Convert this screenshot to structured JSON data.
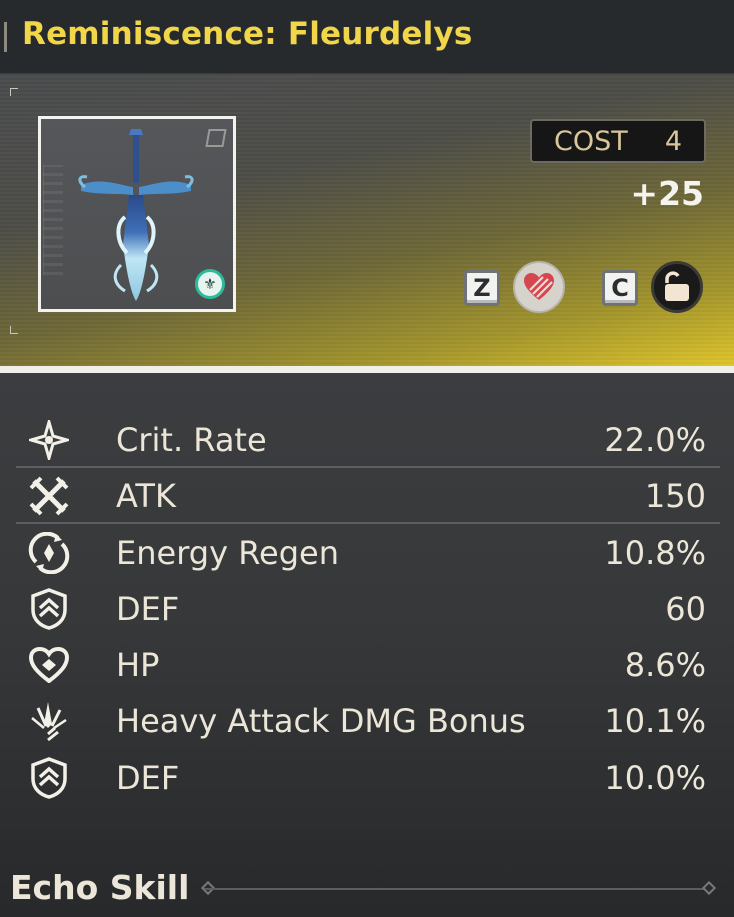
{
  "header": {
    "title": "Reminiscence: Fleurdelys"
  },
  "echo": {
    "cost_label": "COST",
    "cost_value": "4",
    "level": "+25",
    "keys": {
      "favorite_key": "Z",
      "lock_key": "C"
    },
    "sonata_icon": "fleur-sonata-icon",
    "accent_color": "#f2d64a"
  },
  "stats": [
    {
      "icon": "crit-rate-icon",
      "name": "Crit. Rate",
      "value": "22.0%"
    },
    {
      "icon": "atk-icon",
      "name": "ATK",
      "value": "150"
    },
    {
      "icon": "energy-regen-icon",
      "name": "Energy Regen",
      "value": "10.8%"
    },
    {
      "icon": "def-icon",
      "name": "DEF",
      "value": "60"
    },
    {
      "icon": "hp-icon",
      "name": "HP",
      "value": "8.6%"
    },
    {
      "icon": "heavy-attack-icon",
      "name": "Heavy Attack DMG Bonus",
      "value": "10.1%"
    },
    {
      "icon": "def-icon",
      "name": "DEF",
      "value": "10.0%"
    }
  ],
  "section": {
    "echo_skill_label": "Echo Skill"
  }
}
